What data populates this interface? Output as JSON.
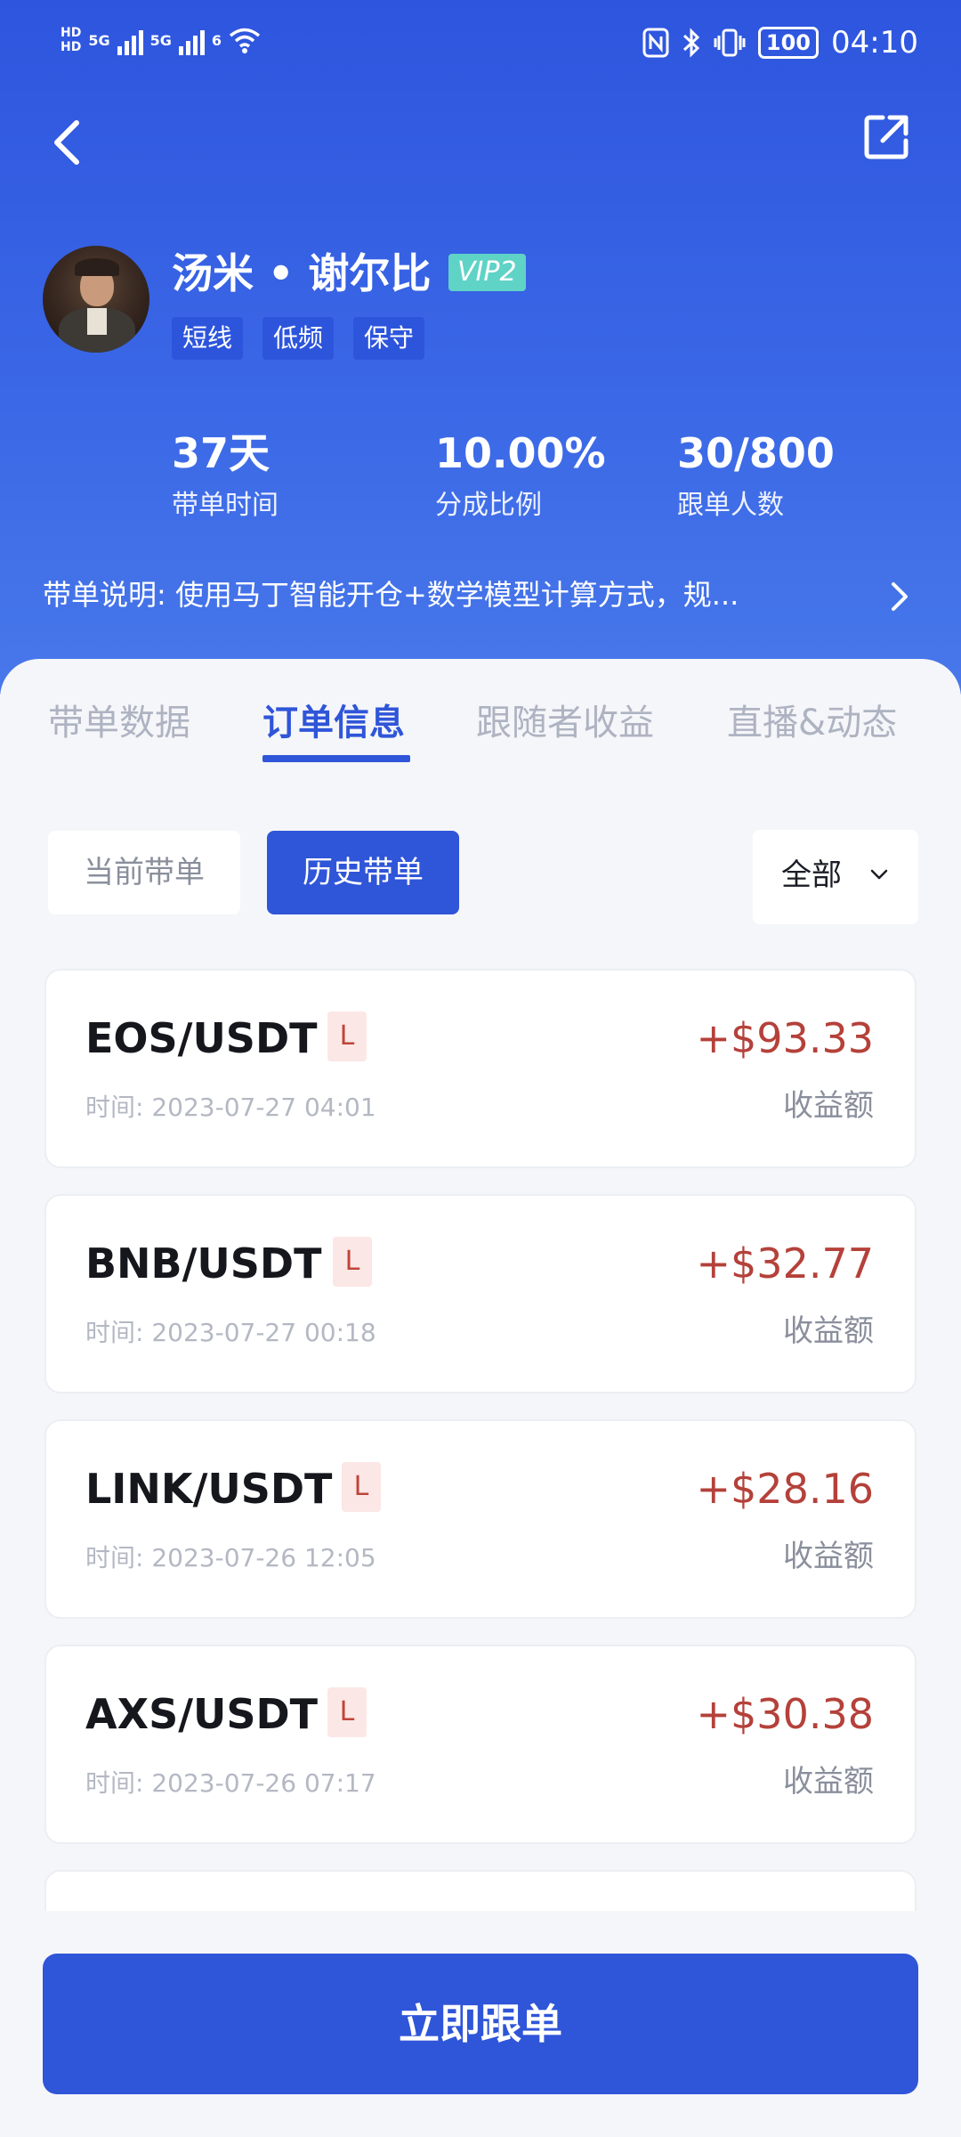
{
  "status_bar": {
    "hd_top": "HD",
    "hd_bottom": "HD",
    "net1": "5G",
    "net2": "5G",
    "wifi_gen": "6",
    "battery": "100",
    "time": "04:10"
  },
  "profile": {
    "name": "汤米 • 谢尔比",
    "vip": "VIP2",
    "tags": [
      "短线",
      "低频",
      "保守"
    ]
  },
  "stats": [
    {
      "value": "37天",
      "label": "带单时间"
    },
    {
      "value": "10.00%",
      "label": "分成比例"
    },
    {
      "value": "30/800",
      "label": "跟单人数"
    }
  ],
  "description": "带单说明: 使用马丁智能开仓+数学模型计算方式，规...",
  "tabs": [
    "带单数据",
    "订单信息",
    "跟随者收益",
    "直播&动态"
  ],
  "active_tab": "订单信息",
  "segments": {
    "current": "当前带单",
    "history": "历史带单"
  },
  "filter": {
    "selected": "全部"
  },
  "orders": [
    {
      "pair": "EOS/USDT",
      "side": "L",
      "time": "时间: 2023-07-27 04:01",
      "amount": "+$93.33",
      "amount_label": "收益额"
    },
    {
      "pair": "BNB/USDT",
      "side": "L",
      "time": "时间: 2023-07-27 00:18",
      "amount": "+$32.77",
      "amount_label": "收益额"
    },
    {
      "pair": "LINK/USDT",
      "side": "L",
      "time": "时间: 2023-07-26 12:05",
      "amount": "+$28.16",
      "amount_label": "收益额"
    },
    {
      "pair": "AXS/USDT",
      "side": "L",
      "time": "时间: 2023-07-26 07:17",
      "amount": "+$30.38",
      "amount_label": "收益额"
    }
  ],
  "cta": "立即跟单",
  "colors": {
    "primary": "#2f55d8",
    "profit": "#b4413a",
    "vip": "#5fd3c6",
    "side_bg": "#fbe7e5"
  }
}
